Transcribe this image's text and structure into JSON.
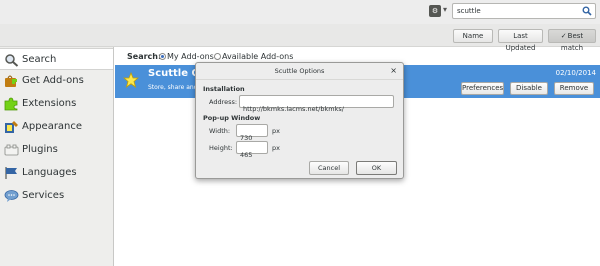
{
  "toolbar": {
    "tools_menu_icon": "gear-menu-icon",
    "search_value": "scuttle",
    "search_icon": "magnifier-icon"
  },
  "sort": {
    "name": "Name",
    "last_updated": "Last Updated",
    "best_match": "Best match",
    "best_match_check": "✓"
  },
  "sidebar": {
    "items": [
      {
        "label": "Search",
        "icon": "search-icon",
        "selected": true
      },
      {
        "label": "Get Add-ons",
        "icon": "get-addons-icon"
      },
      {
        "label": "Extensions",
        "icon": "puzzle-piece-icon"
      },
      {
        "label": "Appearance",
        "icon": "paintbrush-icon"
      },
      {
        "label": "Plugins",
        "icon": "plugin-brick-icon"
      },
      {
        "label": "Languages",
        "icon": "flag-icon"
      },
      {
        "label": "Services",
        "icon": "speech-bubble-icon"
      }
    ]
  },
  "search_filter": {
    "label": "Search:",
    "options": [
      {
        "label": "My Add-ons",
        "selected": true
      },
      {
        "label": "Available Add-ons",
        "selected": false
      }
    ]
  },
  "addon": {
    "name": "Scuttle O",
    "description": "Store, share and",
    "date": "02/10/2014",
    "preferences": "Preferences",
    "disable": "Disable",
    "remove": "Remove"
  },
  "dialog": {
    "title": "Scuttle Options",
    "close": "×",
    "installation_heading": "Installation",
    "address_label": "Address:",
    "address_value": "http://bkmks.lacms.net/bkmks/",
    "popup_heading": "Pop-up Window",
    "width_label": "Width:",
    "width_value": "730",
    "width_unit": "px",
    "height_label": "Height:",
    "height_value": "465",
    "height_unit": "px",
    "cancel": "Cancel",
    "ok": "OK"
  },
  "colors": {
    "selection": "#4a90d9",
    "sidebar": "#eeeeec",
    "toolbar": "#ededed"
  }
}
